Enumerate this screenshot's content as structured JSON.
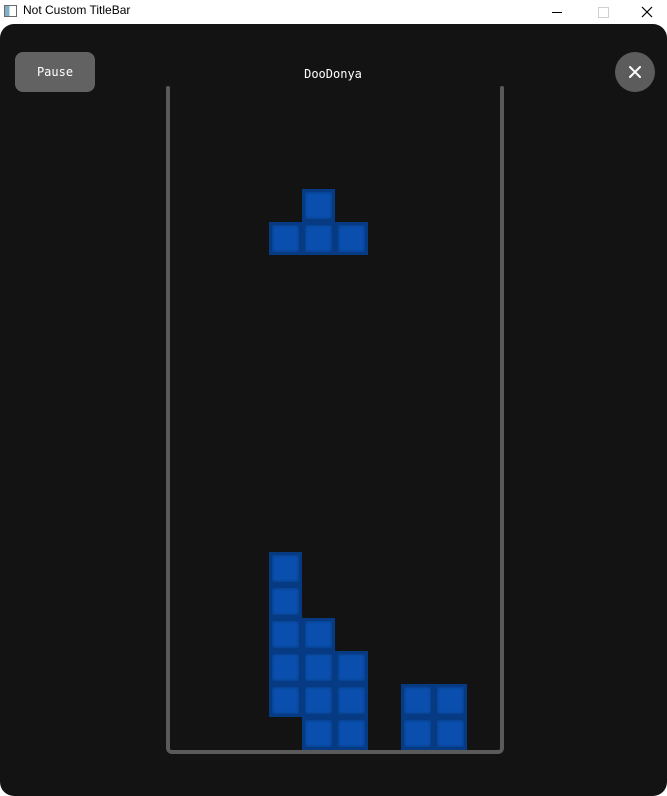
{
  "window": {
    "title": "Not Custom TitleBar"
  },
  "game": {
    "pause_label": "Pause",
    "player_name": "DooDonya",
    "close_icon": "close-icon"
  },
  "board": {
    "columns": 10,
    "rows": 20,
    "block_color": "#0a4fae",
    "block_border_color": "#063a82",
    "active_piece": {
      "shape": "T",
      "cells": [
        [
          4,
          3
        ],
        [
          3,
          4
        ],
        [
          4,
          4
        ],
        [
          5,
          4
        ]
      ]
    },
    "settled_cells": [
      [
        3,
        14
      ],
      [
        3,
        15
      ],
      [
        3,
        16
      ],
      [
        4,
        16
      ],
      [
        3,
        17
      ],
      [
        4,
        17
      ],
      [
        5,
        17
      ],
      [
        3,
        18
      ],
      [
        4,
        18
      ],
      [
        5,
        18
      ],
      [
        7,
        18
      ],
      [
        8,
        18
      ],
      [
        4,
        19
      ],
      [
        5,
        19
      ],
      [
        7,
        19
      ],
      [
        8,
        19
      ]
    ]
  },
  "colors": {
    "background": "#131313",
    "board_wall": "#5a5a5a",
    "button": "#626262"
  }
}
